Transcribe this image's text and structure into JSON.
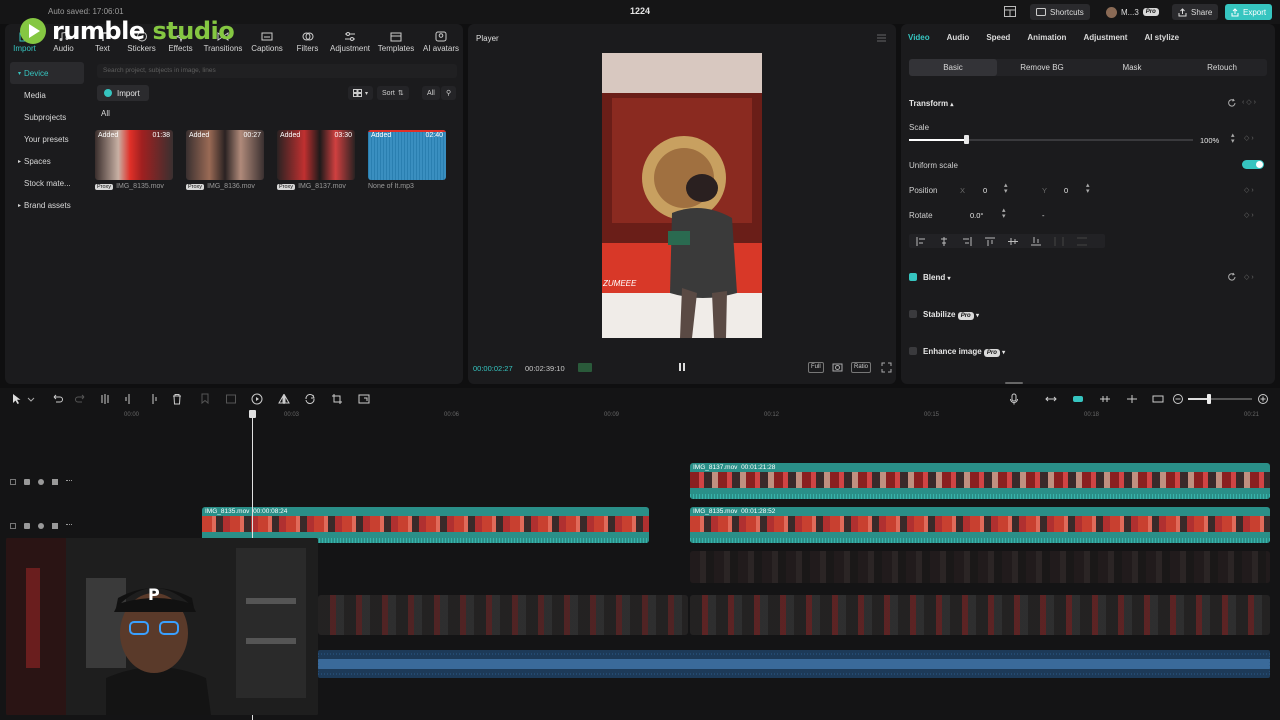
{
  "titlebar": {
    "autosave": "Auto saved: 17:06:01",
    "project_title": "1224",
    "shortcuts_label": "Shortcuts",
    "user_label": "M...3",
    "user_badge": "Pro",
    "share_label": "Share",
    "export_label": "Export"
  },
  "logo": {
    "brand": "rumble",
    "product": "studio"
  },
  "tool_tabs": [
    {
      "label": "Import",
      "icon": "import-icon"
    },
    {
      "label": "Audio",
      "icon": "audio-icon"
    },
    {
      "label": "Text",
      "icon": "text-icon"
    },
    {
      "label": "Stickers",
      "icon": "stickers-icon"
    },
    {
      "label": "Effects",
      "icon": "effects-icon"
    },
    {
      "label": "Transitions",
      "icon": "transitions-icon"
    },
    {
      "label": "Captions",
      "icon": "captions-icon"
    },
    {
      "label": "Filters",
      "icon": "filters-icon"
    },
    {
      "label": "Adjustment",
      "icon": "adjustment-icon"
    },
    {
      "label": "Templates",
      "icon": "templates-icon"
    },
    {
      "label": "AI avatars",
      "icon": "ai-avatar-icon"
    }
  ],
  "sidebar": {
    "items": [
      {
        "label": "Device",
        "active": true
      },
      {
        "label": "Media"
      },
      {
        "label": "Subprojects"
      },
      {
        "label": "Your presets"
      },
      {
        "label": "Spaces"
      },
      {
        "label": "Stock mate..."
      },
      {
        "label": "Brand assets"
      }
    ]
  },
  "media": {
    "search_placeholder": "Search project, subjects in image, lines",
    "import_label": "Import",
    "sort_label": "Sort",
    "filter_label": "All",
    "all_label": "All",
    "items": [
      {
        "added": "Added",
        "duration": "01:38",
        "name": "IMG_8135.mov",
        "proxy": "Proxy"
      },
      {
        "added": "Added",
        "duration": "00:27",
        "name": "IMG_8136.mov",
        "proxy": "Proxy"
      },
      {
        "added": "Added",
        "duration": "03:30",
        "name": "IMG_8137.mov",
        "proxy": "Proxy"
      },
      {
        "added": "Added",
        "duration": "02:40",
        "name": "None of It.mp3",
        "proxy": ""
      }
    ]
  },
  "player": {
    "title": "Player",
    "current_time": "00:00:02:27",
    "total_time": "00:02:39:10",
    "overlay_text": "ZUMEEE",
    "controls": [
      "Full",
      "Ratio"
    ]
  },
  "inspector": {
    "tabs": [
      "Video",
      "Audio",
      "Speed",
      "Animation",
      "Adjustment",
      "AI stylize"
    ],
    "sub_tabs": [
      "Basic",
      "Remove BG",
      "Mask",
      "Retouch"
    ],
    "transform_title": "Transform",
    "scale_label": "Scale",
    "scale_value": "100%",
    "scale_fraction": 0.2,
    "uniform_scale_label": "Uniform scale",
    "uniform_scale_on": true,
    "position_label": "Position",
    "pos_x_label": "X",
    "pos_x": "0",
    "pos_y_label": "Y",
    "pos_y": "0",
    "rotate_label": "Rotate",
    "rotate_value": "0.0°",
    "rotate_extra": "-",
    "blend_label": "Blend",
    "stabilize_label": "Stabilize",
    "enhance_label": "Enhance image",
    "pro_badge": "Pro"
  },
  "timeline": {
    "ruler": [
      "00:00",
      "00:03",
      "00:06",
      "00:09",
      "00:12",
      "00:15",
      "00:18",
      "00:21"
    ],
    "clips": [
      {
        "name": "IMG_8137.mov",
        "duration": "00:01:21:28"
      },
      {
        "name": "IMG_8135.mov",
        "duration": "00:00:08:24"
      },
      {
        "name": "IMG_8135.mov",
        "duration": "00:01:28:52"
      }
    ]
  },
  "colors": {
    "accent": "#36c5c0",
    "brand_green": "#85c742",
    "clip": "#2a8f88",
    "audio": "#1d3a58",
    "export": "#36c5c0"
  }
}
